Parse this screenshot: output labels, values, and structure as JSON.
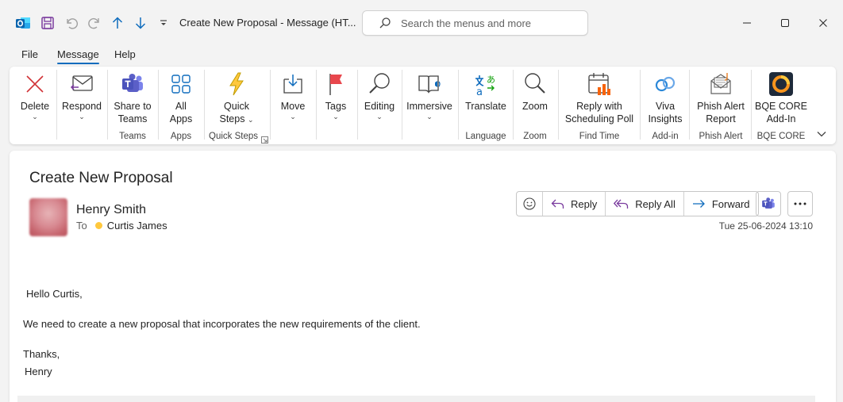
{
  "window": {
    "title": "Create New Proposal  -  Message (HT...",
    "search_placeholder": "Search the menus and more"
  },
  "menu": [
    "File",
    "Message",
    "Help"
  ],
  "ribbon": {
    "delete": "Delete",
    "respond": "Respond",
    "share_line1": "Share to",
    "share_line2": "Teams",
    "group_teams": "Teams",
    "allapps_line1": "All",
    "allapps_line2": "Apps",
    "group_apps": "Apps",
    "quick_line1": "Quick",
    "quick_line2": "Steps",
    "group_quicksteps": "Quick Steps",
    "move": "Move",
    "tags": "Tags",
    "editing": "Editing",
    "immersive": "Immersive",
    "translate": "Translate",
    "group_language": "Language",
    "zoom": "Zoom",
    "group_zoom": "Zoom",
    "sched_line1": "Reply with",
    "sched_line2": "Scheduling Poll",
    "group_findtime": "Find Time",
    "viva_line1": "Viva",
    "viva_line2": "Insights",
    "group_addin": "Add-in",
    "phish_line1": "Phish Alert",
    "phish_line2": "Report",
    "group_phish": "Phish Alert",
    "bqe_line1": "BQE CORE",
    "bqe_line2": "Add-In",
    "group_bqe": "BQE CORE"
  },
  "message": {
    "subject": "Create New Proposal",
    "sender": "Henry Smith",
    "to_label": "To",
    "recipient": "Curtis James",
    "date": "Tue 25-06-2024 13:10",
    "actions": {
      "reply": "Reply",
      "reply_all": "Reply All",
      "forward": "Forward"
    },
    "body": {
      "greeting": "Hello Curtis,",
      "text": "We need to create a new proposal that incorporates the new requirements of the client.",
      "closing": "Thanks,",
      "signature": "Henry"
    }
  },
  "colors": {
    "accent": "#0f6cbd",
    "delete_red": "#d13438",
    "teams_purple": "#5b5fc7",
    "presence_yellow": "#ffc83d"
  }
}
